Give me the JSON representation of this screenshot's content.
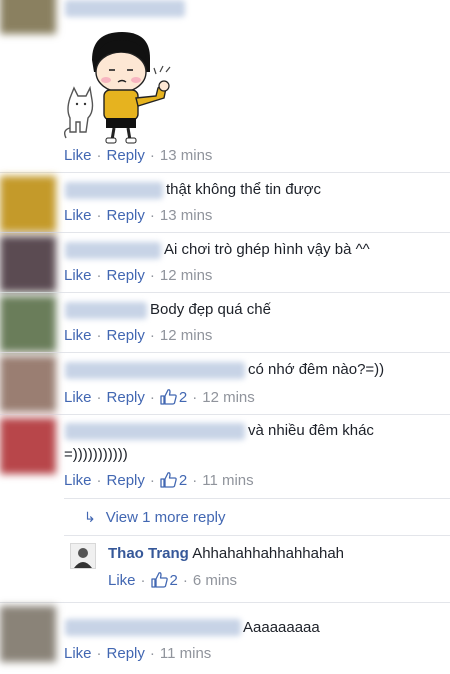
{
  "comments": [
    {
      "text": "",
      "like": "Like",
      "reply": "Reply",
      "time": "13 mins"
    },
    {
      "text": "thật không thể tin được",
      "like": "Like",
      "reply": "Reply",
      "time": "13 mins"
    },
    {
      "text": "Ai chơi trò ghép hình vậy bà ^^",
      "like": "Like",
      "reply": "Reply",
      "time": "12 mins"
    },
    {
      "text": "Body đẹp quá chế",
      "like": "Like",
      "reply": "Reply",
      "time": "12 mins"
    },
    {
      "text": "có nhớ đêm nào?=))",
      "like": "Like",
      "reply": "Reply",
      "reactions": "2",
      "time": "12 mins"
    },
    {
      "text_line1": "và nhiều đêm khác",
      "text_line2": "=)))))))))))",
      "like": "Like",
      "reply": "Reply",
      "reactions": "2",
      "time": "11 mins"
    },
    {
      "text": "Aaaaaaaaa",
      "like": "Like",
      "reply": "Reply",
      "time": "11 mins"
    }
  ],
  "view_more": "View 1 more reply",
  "nested_reply": {
    "name": "Thao Trang",
    "text": "Ahhahahhahhahhahah",
    "like": "Like",
    "reactions": "2",
    "time": "6 mins"
  },
  "colors": {
    "link": "#4267b2",
    "meta": "#90949c",
    "text": "#1d2129",
    "name": "#365899"
  }
}
